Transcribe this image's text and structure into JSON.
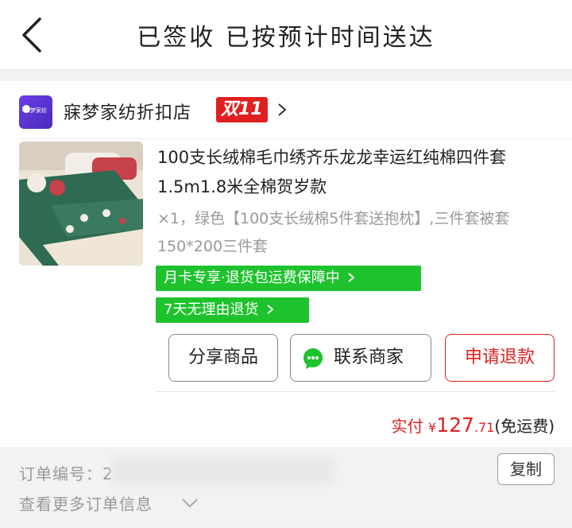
{
  "header": {
    "title": "已签收 已按预计时间送达"
  },
  "shop": {
    "logo_text": "寐梦家纺",
    "name": "寐梦家纺折扣店",
    "badge": "双11"
  },
  "product": {
    "title": "100支长绒棉毛巾绣齐乐龙龙幸运红纯棉四件套1.5m1.8米全棉贺岁款",
    "spec": "×1，绿色【100支长绒棉5件套送抱枕】,三件套被套150*200三件套",
    "tags": [
      "月卡专享·退货包运费保障中",
      "7天无理由退货"
    ]
  },
  "buttons": {
    "share": "分享商品",
    "contact": "联系商家",
    "refund": "申请退款"
  },
  "payment": {
    "label": "实付",
    "currency": "¥",
    "integer": "127",
    "decimal": ".71",
    "note": "(免运费)"
  },
  "order": {
    "number_label": "订单编号：2",
    "copy": "复制",
    "more": "查看更多订单信息"
  },
  "colors": {
    "accent_red": "#e02020",
    "green_tag": "#1ec22d",
    "logo_purple": "#5b34d8"
  }
}
